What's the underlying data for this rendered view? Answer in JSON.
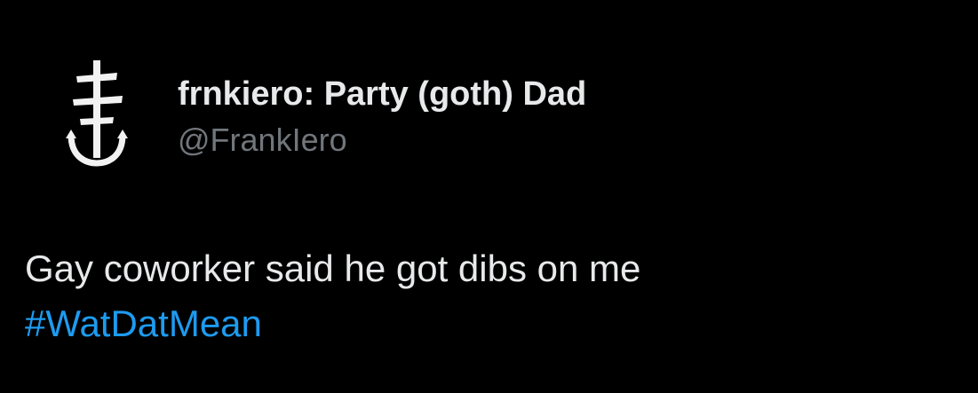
{
  "tweet": {
    "author": {
      "display_name": "frnkiero: Party (goth) Dad",
      "handle": "@FrankIero",
      "avatar_icon": "cross-anchor-logo-icon"
    },
    "text_line": "Gay coworker said he got dibs on me",
    "hashtag": "#WatDatMean"
  },
  "colors": {
    "background": "#000000",
    "text_primary": "#e7e9ea",
    "text_secondary": "#71767b",
    "link": "#1d9bf0"
  }
}
